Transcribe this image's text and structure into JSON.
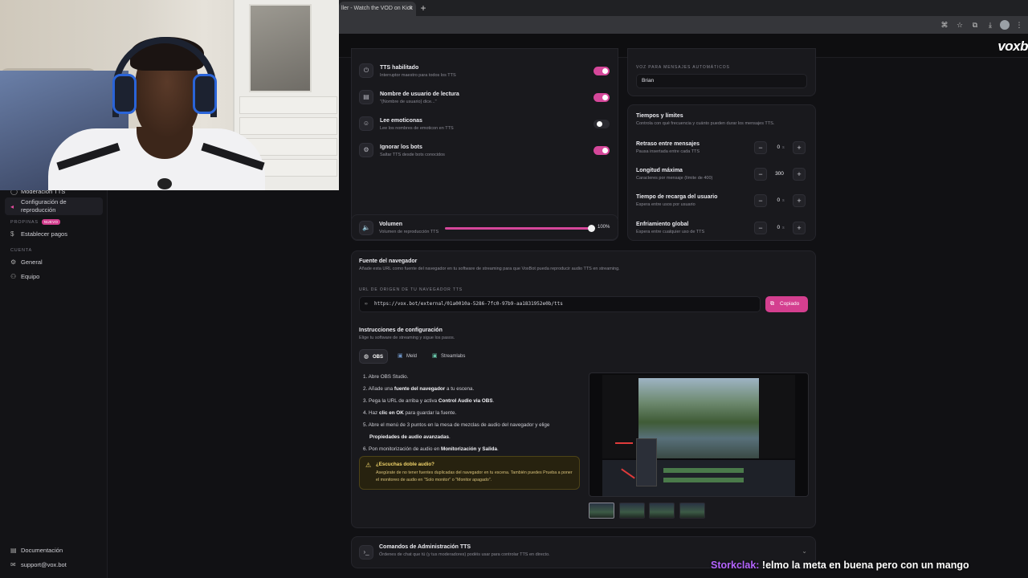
{
  "browser": {
    "tab_title": "ller - Watch the VOD on Kick",
    "tab_close": "×",
    "new_tab": "+"
  },
  "app": {
    "brand": "voxb"
  },
  "sidebar": {
    "items": [
      {
        "label": "Moderación TTS",
        "icon": "shield-icon"
      },
      {
        "label": "Configuración de reproducción",
        "icon": "playback-icon"
      },
      {
        "label": "Establecer pagos",
        "icon": "dollar-icon"
      },
      {
        "label": "General",
        "icon": "gear-icon"
      },
      {
        "label": "Equipo",
        "icon": "users-icon"
      },
      {
        "label": "Documentación",
        "icon": "book-icon"
      },
      {
        "label": "support@vox.bot",
        "icon": "mail-icon"
      }
    ],
    "sections": {
      "propinas": "PROPINAS",
      "propinas_badge": "NUEVO",
      "cuenta": "CUENTA"
    }
  },
  "tts_toggles": [
    {
      "title": "TTS habilitado",
      "sub": "Interruptor maestro para todos los TTS",
      "on": true,
      "icon": "power-icon"
    },
    {
      "title": "Nombre de usuario de lectura",
      "sub": "\"{Nombre de usuario} dice...\"",
      "on": true,
      "icon": "id-card-icon"
    },
    {
      "title": "Lee emoticonas",
      "sub": "Lee los nombres de emoticon en TTS",
      "on": false,
      "icon": "emoji-icon"
    },
    {
      "title": "Ignorar los bots",
      "sub": "Saltar TTS desde bots conocidos",
      "on": true,
      "icon": "bot-icon"
    }
  ],
  "volume": {
    "title": "Volumen",
    "sub": "Volumen de reproducción TTS",
    "value_label": "100%",
    "level": 1.0
  },
  "auto_voice": {
    "kicker": "VOZ PARA MENSAJES AUTOMÁTICOS",
    "value": "Brian"
  },
  "limits": {
    "title": "Tiempos y límites",
    "sub": "Controla con qué frecuencia y cuánto pueden durar los mensajes TTS.",
    "rows": [
      {
        "title": "Retraso entre mensajes",
        "sub": "Pausa insertada entre cada TTS",
        "value": "0",
        "unit": "s"
      },
      {
        "title": "Longitud máxima",
        "sub": "Caracteres por mensaje (límite de 400)",
        "value": "300",
        "unit": ""
      },
      {
        "title": "Tiempo de recarga del usuario",
        "sub": "Espera entre usos por usuario",
        "value": "0",
        "unit": "s"
      },
      {
        "title": "Enfriamiento global",
        "sub": "Espera entre cualquier uso de TTS",
        "value": "0",
        "unit": "s"
      }
    ],
    "minus": "−",
    "plus": "+"
  },
  "browser_source": {
    "title": "Fuente del navegador",
    "sub": "Añade esta URL como fuente del navegador en tu software de streaming para que VoxBot pueda reproducir audio TTS en streaming.",
    "url_kicker": "URL DE ORIGEN DE TU NAVEGADOR TTS",
    "url": "https://vox.bot/external/01a0010a-5286-7fc0-97b9-aa1831952e0b/tts",
    "copy_button": "Copiado"
  },
  "setup": {
    "title": "Instrucciones de configuración",
    "sub": "Elige tu software de streaming y sigue los pasos.",
    "tabs": [
      {
        "label": "OBS",
        "active": true
      },
      {
        "label": "Meld",
        "active": false
      },
      {
        "label": "Streamlabs",
        "active": false
      }
    ],
    "steps": {
      "s1": "1. Abre OBS Studio.",
      "s2a": "2. Añade una ",
      "s2b": "fuente del navegador",
      "s2c": " a tu escena.",
      "s3a": "3. Pega la URL de arriba y activa ",
      "s3b": "Control Audio via OBS",
      "s3c": ".",
      "s4a": "4. Haz ",
      "s4b": "clic en OK",
      "s4c": " para guardar la fuente.",
      "s5a": "5. Abre el menú de 3 puntos en la mesa de mezclas de audio del navegador y elige",
      "s5b": "Propiedades de audio avanzadas",
      "s5c": ".",
      "s6a": "6. Pon monitorización de audio en ",
      "s6b": "Monitorización y Salida",
      "s6c": "."
    },
    "warning": {
      "title": "¿Escuchas doble audio?",
      "body": "Asegúrate de no tener fuentes duplicadas del navegador en tu escena. También puedes Prueba a poner el monitoreo de audio en \"Solo monitor\" o \"Monitor apagado\"."
    }
  },
  "admin_commands": {
    "title": "Comandos de Administración TTS",
    "sub": "Órdenes de chat que tú (y tus moderadores) podéis usar para controlar TTS en directo."
  },
  "chat_overlay": {
    "user": "Storkclak:",
    "message": " !elmo la meta en buena pero con un mango"
  },
  "colors": {
    "accent": "#d5479a",
    "background": "#111114",
    "card": "#19191d",
    "chat_user": "#b565ff"
  }
}
